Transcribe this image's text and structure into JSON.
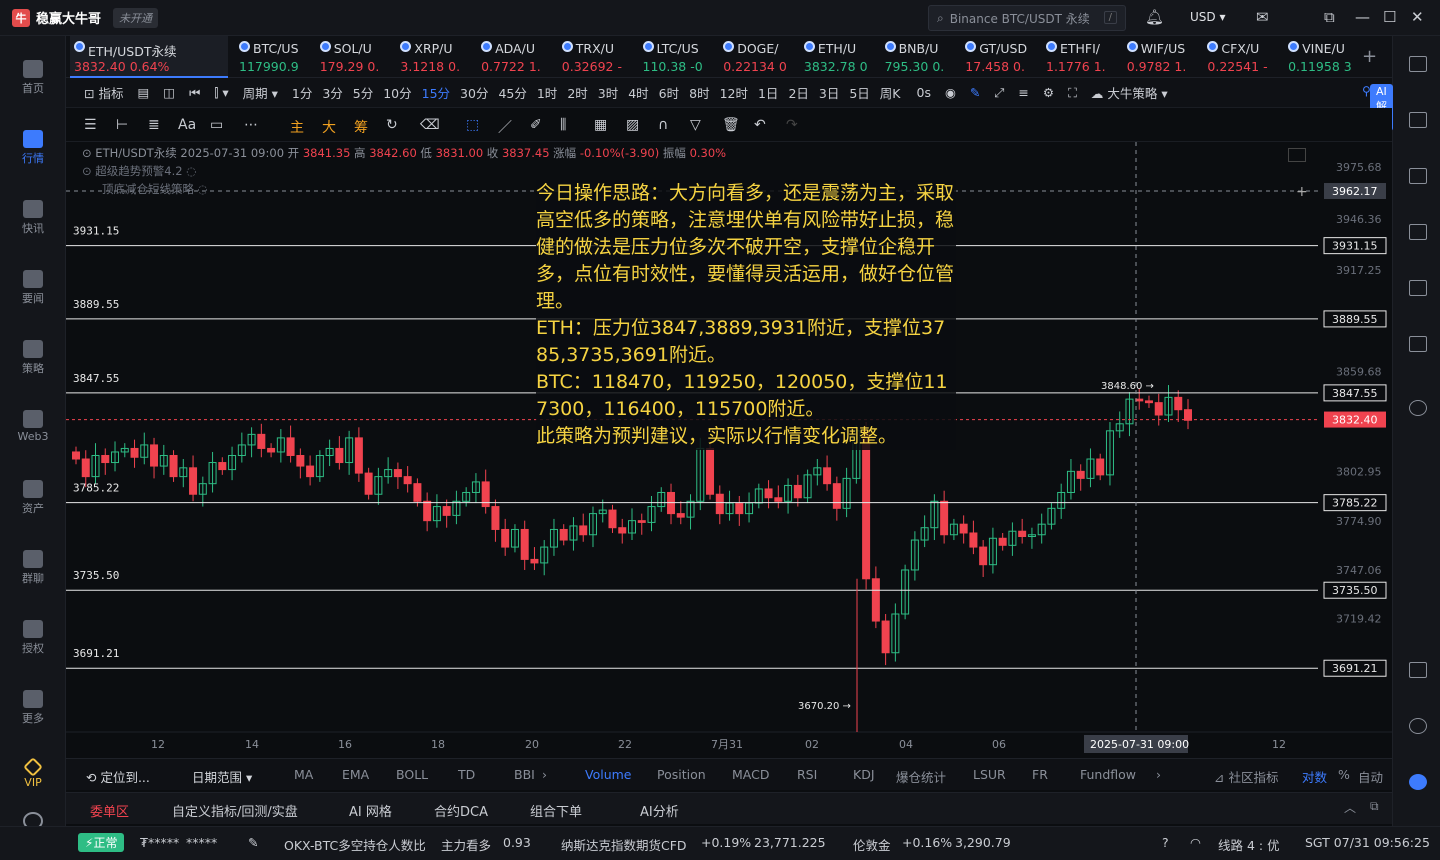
{
  "app": {
    "title": "稳赢大牛哥",
    "badge": "未开通"
  },
  "search": {
    "placeholder": "Binance BTC/USDT 永续",
    "shortcut": "/"
  },
  "currency": "USD ▾",
  "leftnav": [
    {
      "label": "首页",
      "icon": "home-icon"
    },
    {
      "label": "行情",
      "icon": "market-icon",
      "active": true
    },
    {
      "label": "快讯",
      "icon": "flash-news-icon"
    },
    {
      "label": "要闻",
      "icon": "news-icon"
    },
    {
      "label": "策略",
      "icon": "strategy-icon"
    },
    {
      "label": "Web3",
      "icon": "web3-icon"
    },
    {
      "label": "资产",
      "icon": "wallet-icon"
    },
    {
      "label": "群聊",
      "icon": "chat-icon"
    },
    {
      "label": "授权",
      "icon": "key-icon"
    },
    {
      "label": "更多",
      "icon": "grid-icon"
    },
    {
      "label": "VIP",
      "icon": "vip-icon",
      "vip": true
    }
  ],
  "tickers": [
    {
      "name": "ETH/USDT永续",
      "price": "3832.40",
      "change": "0.64%",
      "dir": "dn"
    },
    {
      "name": "BTC/US",
      "price": "117990.9",
      "change": "",
      "dir": "up"
    },
    {
      "name": "SOL/U",
      "price": "179.29",
      "change": "0.",
      "dir": "dn"
    },
    {
      "name": "XRP/U",
      "price": "3.1218",
      "change": "0.",
      "dir": "dn"
    },
    {
      "name": "ADA/U",
      "price": "0.7722",
      "change": "1.",
      "dir": "dn"
    },
    {
      "name": "TRX/U",
      "price": "0.32692",
      "change": "-",
      "dir": "dn"
    },
    {
      "name": "LTC/US",
      "price": "110.38",
      "change": "-0",
      "dir": "up"
    },
    {
      "name": "DOGE/",
      "price": "0.22134",
      "change": "0",
      "dir": "dn"
    },
    {
      "name": "ETH/U",
      "price": "3832.78",
      "change": "0",
      "dir": "up"
    },
    {
      "name": "BNB/U",
      "price": "795.30",
      "change": "0.",
      "dir": "up"
    },
    {
      "name": "GT/USD",
      "price": "17.458",
      "change": "0.",
      "dir": "dn"
    },
    {
      "name": "ETHFI/",
      "price": "1.1776",
      "change": "1.",
      "dir": "dn"
    },
    {
      "name": "WIF/US",
      "price": "0.9782",
      "change": "1.",
      "dir": "dn"
    },
    {
      "name": "CFX/U",
      "price": "0.22541",
      "change": "-",
      "dir": "dn"
    },
    {
      "name": "VINE/U",
      "price": "0.11958",
      "change": "3",
      "dir": "up"
    }
  ],
  "toolbar": {
    "indicator": "指标",
    "period": "周期",
    "timeframes": [
      "1分",
      "3分",
      "5分",
      "10分",
      "15分",
      "30分",
      "45分",
      "1时",
      "2时",
      "3时",
      "4时",
      "6时",
      "8时",
      "12时",
      "1日",
      "2日",
      "3日",
      "5日",
      "周K"
    ],
    "selected": "15分",
    "countdown": "0s",
    "strategy": "大牛策略",
    "ai": "AI解读"
  },
  "drawbar": {
    "labels": [
      "Aa",
      "主",
      "大",
      "筹"
    ]
  },
  "info": {
    "symbol": "ETH/USDT永续",
    "time": "2025-07-31 09:00",
    "open_label": "开",
    "open": "3841.35",
    "high_label": "高",
    "high": "3842.60",
    "low_label": "低",
    "low": "3831.00",
    "close_label": "收",
    "close": "3837.45",
    "chg_label": "涨幅",
    "chg": "-0.10%(-3.90)",
    "amp_label": "振幅",
    "amp": "0.30%",
    "ind1": "超级趋势预警4.2",
    "ind2": "顶底减仓短线策略"
  },
  "annotation": [
    "今日操作思路：大方向看多，还是震荡为主，采取高空低多的策略，注意埋伏单有风险带好止损，稳健的做法是压力位多次不破开空，支撑位企稳开多，点位有时效性，要懂得灵活运用，做好仓位管理。",
    "ETH：压力位3847,3889,3931附近，支撑位3785,3735,3691附近。",
    "BTC：118470，119250，120050，支撑位117300，116400，115700附近。",
    "此策略为预判建议，实际以行情变化调整。"
  ],
  "chart_data": {
    "type": "candlestick",
    "symbol": "ETH/USDT永续",
    "interval": "15分",
    "ylim": [
      3655,
      3990
    ],
    "y_ticks": [
      "3975.68",
      "3946.36",
      "3917.25",
      "3859.68",
      "3802.95",
      "3774.90",
      "3747.06",
      "3719.42"
    ],
    "x_ticks": [
      "12",
      "14",
      "16",
      "18",
      "20",
      "22",
      "7月31",
      "02",
      "04",
      "06",
      "12"
    ],
    "crosshair": {
      "x_label": "2025-07-31 09:00",
      "y_label": "3962.17",
      "y_value": 3962.17
    },
    "current_price": {
      "value": 3832.4,
      "label": "3832.40"
    },
    "levels": [
      {
        "value": 3931.15,
        "label": "3931.15"
      },
      {
        "value": 3889.55,
        "label": "3889.55"
      },
      {
        "value": 3847.55,
        "label": "3847.55"
      },
      {
        "value": 3785.22,
        "label": "3785.22"
      },
      {
        "value": 3735.5,
        "label": "3735.50"
      },
      {
        "value": 3691.21,
        "label": "3691.21"
      }
    ],
    "high_marker": {
      "value": 3848.6,
      "label": "3848.60 →"
    },
    "low_marker": {
      "value": 3670.2,
      "label": "3670.20 →"
    },
    "closes": [
      3810,
      3800,
      3812,
      3808,
      3814,
      3816,
      3811,
      3818,
      3806,
      3812,
      3800,
      3805,
      3790,
      3796,
      3808,
      3804,
      3812,
      3818,
      3824,
      3816,
      3814,
      3822,
      3812,
      3806,
      3800,
      3812,
      3816,
      3808,
      3822,
      3802,
      3790,
      3800,
      3804,
      3800,
      3796,
      3786,
      3775,
      3783,
      3778,
      3786,
      3791,
      3797,
      3783,
      3770,
      3760,
      3770,
      3753,
      3751,
      3760,
      3770,
      3764,
      3772,
      3767,
      3779,
      3781,
      3771,
      3768,
      3775,
      3774,
      3783,
      3791,
      3779,
      3777,
      3786,
      3816,
      3790,
      3779,
      3785,
      3779,
      3785,
      3793,
      3788,
      3786,
      3795,
      3788,
      3801,
      3805,
      3796,
      3782,
      3799,
      3826,
      3742,
      3718,
      3700,
      3722,
      3747,
      3764,
      3771,
      3786,
      3767,
      3773,
      3768,
      3760,
      3750,
      3765,
      3761,
      3769,
      3766,
      3767,
      3773,
      3782,
      3791,
      3803,
      3799,
      3810,
      3801,
      3826,
      3830,
      3844,
      3843,
      3842,
      3835,
      3845,
      3838,
      3832
    ],
    "x_labels": [
      "12",
      "14",
      "16",
      "18",
      "20",
      "22",
      "7月31",
      "02",
      "04",
      "06",
      "12"
    ]
  },
  "bottomtabs": {
    "locate": "定位到...",
    "range": "日期范围 ▾",
    "items": [
      "MA",
      "EMA",
      "BOLL",
      "TD",
      "BBI",
      "Volume",
      "Position",
      "MACD",
      "RSI",
      "KDJ",
      "爆仓统计",
      "LSUR",
      "FR",
      "Fundflow"
    ],
    "selected": "Volume",
    "community": "社区指标",
    "compare": "对数",
    "pct": "%",
    "auto": "自动"
  },
  "panel": {
    "items": [
      "委单区",
      "自定义指标/回测/实盘",
      "AI 网格",
      "合约DCA",
      "组合下单",
      "AI分析"
    ],
    "selected": "委单区"
  },
  "status": {
    "normal": "正常",
    "masked1": "₮*****",
    "masked2": "*****",
    "ticker1_name": "OKX-BTC多空持仓人数比",
    "ticker1_tag": "主力看多",
    "ticker1_val": "0.93",
    "ticker2_name": "纳斯达克指数期货CFD",
    "ticker2_chg": "+0.19%",
    "ticker2_val": "23,771.225",
    "ticker3_name": "伦敦金",
    "ticker3_chg": "+0.16%",
    "ticker3_val": "3,290.79",
    "line": "线路 4 : 优",
    "clock": "SGT 07/31 09:56:25"
  }
}
